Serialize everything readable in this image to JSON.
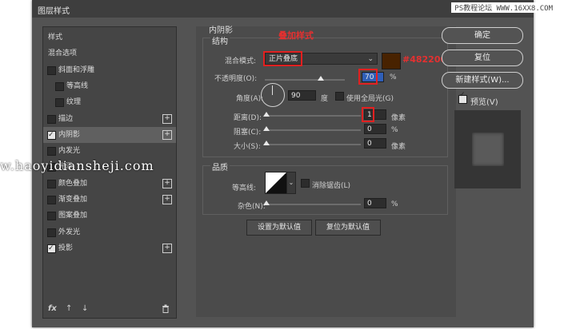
{
  "window": {
    "title": "图层样式",
    "close_glyph": "×"
  },
  "watermark_top": "PS教程论坛 WWW.16XX8.COM",
  "watermark": "w.haoyidiansheji.com",
  "left_panel": {
    "items": [
      {
        "label": "样式",
        "checkbox": false,
        "checked": false,
        "plus": false,
        "selected": false
      },
      {
        "label": "混合选项",
        "checkbox": false,
        "checked": false,
        "plus": false,
        "selected": false
      },
      {
        "label": "斜面和浮雕",
        "checkbox": true,
        "checked": false,
        "plus": false,
        "selected": false
      },
      {
        "label": "等高线",
        "checkbox": true,
        "checked": false,
        "plus": false,
        "selected": false,
        "indent": true
      },
      {
        "label": "纹理",
        "checkbox": true,
        "checked": false,
        "plus": false,
        "selected": false,
        "indent": true
      },
      {
        "label": "描边",
        "checkbox": true,
        "checked": false,
        "plus": true,
        "selected": false
      },
      {
        "label": "内阴影",
        "checkbox": true,
        "checked": true,
        "plus": true,
        "selected": true
      },
      {
        "label": "内发光",
        "checkbox": true,
        "checked": false,
        "plus": false,
        "selected": false
      },
      {
        "label": "光泽",
        "checkbox": true,
        "checked": false,
        "plus": false,
        "selected": false
      },
      {
        "label": "颜色叠加",
        "checkbox": true,
        "checked": false,
        "plus": true,
        "selected": false
      },
      {
        "label": "渐变叠加",
        "checkbox": true,
        "checked": false,
        "plus": true,
        "selected": false
      },
      {
        "label": "图案叠加",
        "checkbox": true,
        "checked": false,
        "plus": false,
        "selected": false
      },
      {
        "label": "外发光",
        "checkbox": true,
        "checked": false,
        "plus": false,
        "selected": false
      },
      {
        "label": "投影",
        "checkbox": true,
        "checked": true,
        "plus": true,
        "selected": false
      }
    ],
    "bottom_icons": [
      "fx",
      "↑",
      "↓",
      "🗑"
    ]
  },
  "inner_shadow": {
    "section_title": "内阴影",
    "structure_title": "结构",
    "annotation": "叠加样式",
    "blend_mode_label": "混合模式:",
    "blend_mode_value": "正片叠底",
    "color_hex_note": "#482200",
    "swatch_color": "#482200",
    "opacity_label": "不透明度(O):",
    "opacity_value": "70",
    "opacity_unit": "%",
    "opacity_level": 0.7,
    "angle_label": "角度(A):",
    "angle_value": "90",
    "angle_unit": "度",
    "global_light_label": "使用全局光(G)",
    "distance_label": "距离(D):",
    "distance_value": "1",
    "distance_unit": "像素",
    "choke_label": "阻塞(C):",
    "choke_value": "0",
    "choke_unit": "%",
    "size_label": "大小(S):",
    "size_value": "0",
    "size_unit": "像素",
    "quality_title": "品质",
    "contour_label": "等高线:",
    "anti_alias_label": "消除锯齿(L)",
    "noise_label": "杂色(N):",
    "noise_value": "0",
    "noise_unit": "%",
    "set_default_button": "设置为默认值",
    "reset_default_button": "复位为默认值"
  },
  "right_panel": {
    "ok_button": "确定",
    "reset_button": "复位",
    "new_style_button": "新建样式(W)...",
    "preview_label": "预览(V)",
    "preview_checked": true
  }
}
